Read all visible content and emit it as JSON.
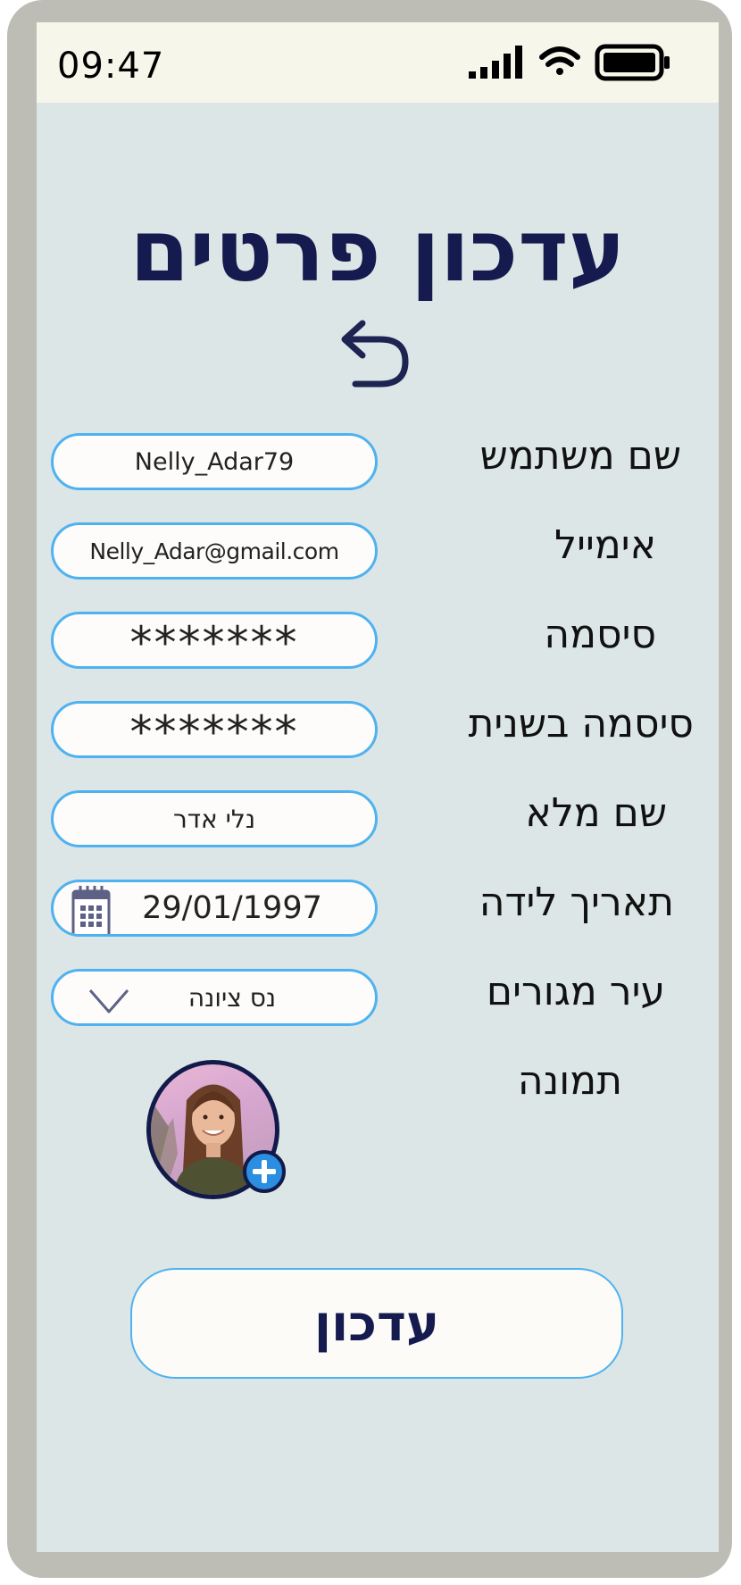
{
  "status_bar": {
    "time": "09:47",
    "icons": [
      "cellular-signal-icon",
      "wifi-icon",
      "battery-icon"
    ]
  },
  "header": {
    "title": "עדכון פרטים",
    "back_icon": "back-arrow-icon"
  },
  "form": {
    "username": {
      "label": "שם משתמש",
      "value": "Nelly_Adar79"
    },
    "email": {
      "label": "אימייל",
      "value": "Nelly_Adar@gmail.com"
    },
    "password": {
      "label": "סיסמה",
      "value": "*******"
    },
    "password_confirm": {
      "label": "סיסמה בשנית",
      "value": "*******"
    },
    "full_name": {
      "label": "שם מלא",
      "value": "נלי אדר"
    },
    "birth_date": {
      "label": "תאריך לידה",
      "value": "29/01/1997",
      "icon": "calendar-icon"
    },
    "city": {
      "label": "עיר מגורים",
      "value": "נס ציונה",
      "icon": "chevron-down-icon"
    },
    "photo": {
      "label": "תמונה",
      "add_icon": "add-photo-plus-icon"
    }
  },
  "submit_label": "עדכון",
  "colors": {
    "screen_bg": "#dce6e7",
    "statusbar_bg": "#f7f6ea",
    "frame": "#bdbdb5",
    "title": "#151b4e",
    "field_border": "#4fb2f0",
    "plus_blue": "#2b8ee0"
  }
}
